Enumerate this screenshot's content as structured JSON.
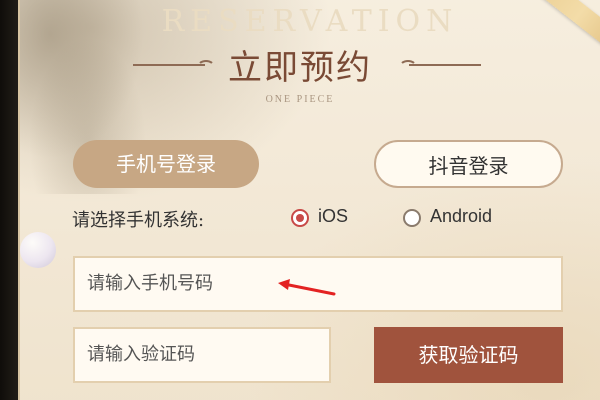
{
  "header": {
    "background_word": "RESERVATION",
    "title": "立即预约",
    "subtitle": "ONE PIECE"
  },
  "login_tabs": {
    "phone_login": "手机号登录",
    "douyin_login": "抖音登录"
  },
  "os_select": {
    "label": "请选择手机系统:",
    "options": [
      {
        "label": "iOS",
        "selected": true
      },
      {
        "label": "Android",
        "selected": false
      }
    ]
  },
  "phone_input": {
    "placeholder": "请输入手机号码"
  },
  "code_input": {
    "placeholder": "请输入验证码"
  },
  "get_code_button": "获取验证码",
  "colors": {
    "accent": "#a0533d",
    "primary_tab": "#c7a784",
    "radio_selected": "#c84a48"
  },
  "icons": {
    "annotation_arrow": "red-arrow-icon",
    "radio_selected": "radio-selected-icon",
    "radio_unselected": "radio-unselected-icon"
  }
}
